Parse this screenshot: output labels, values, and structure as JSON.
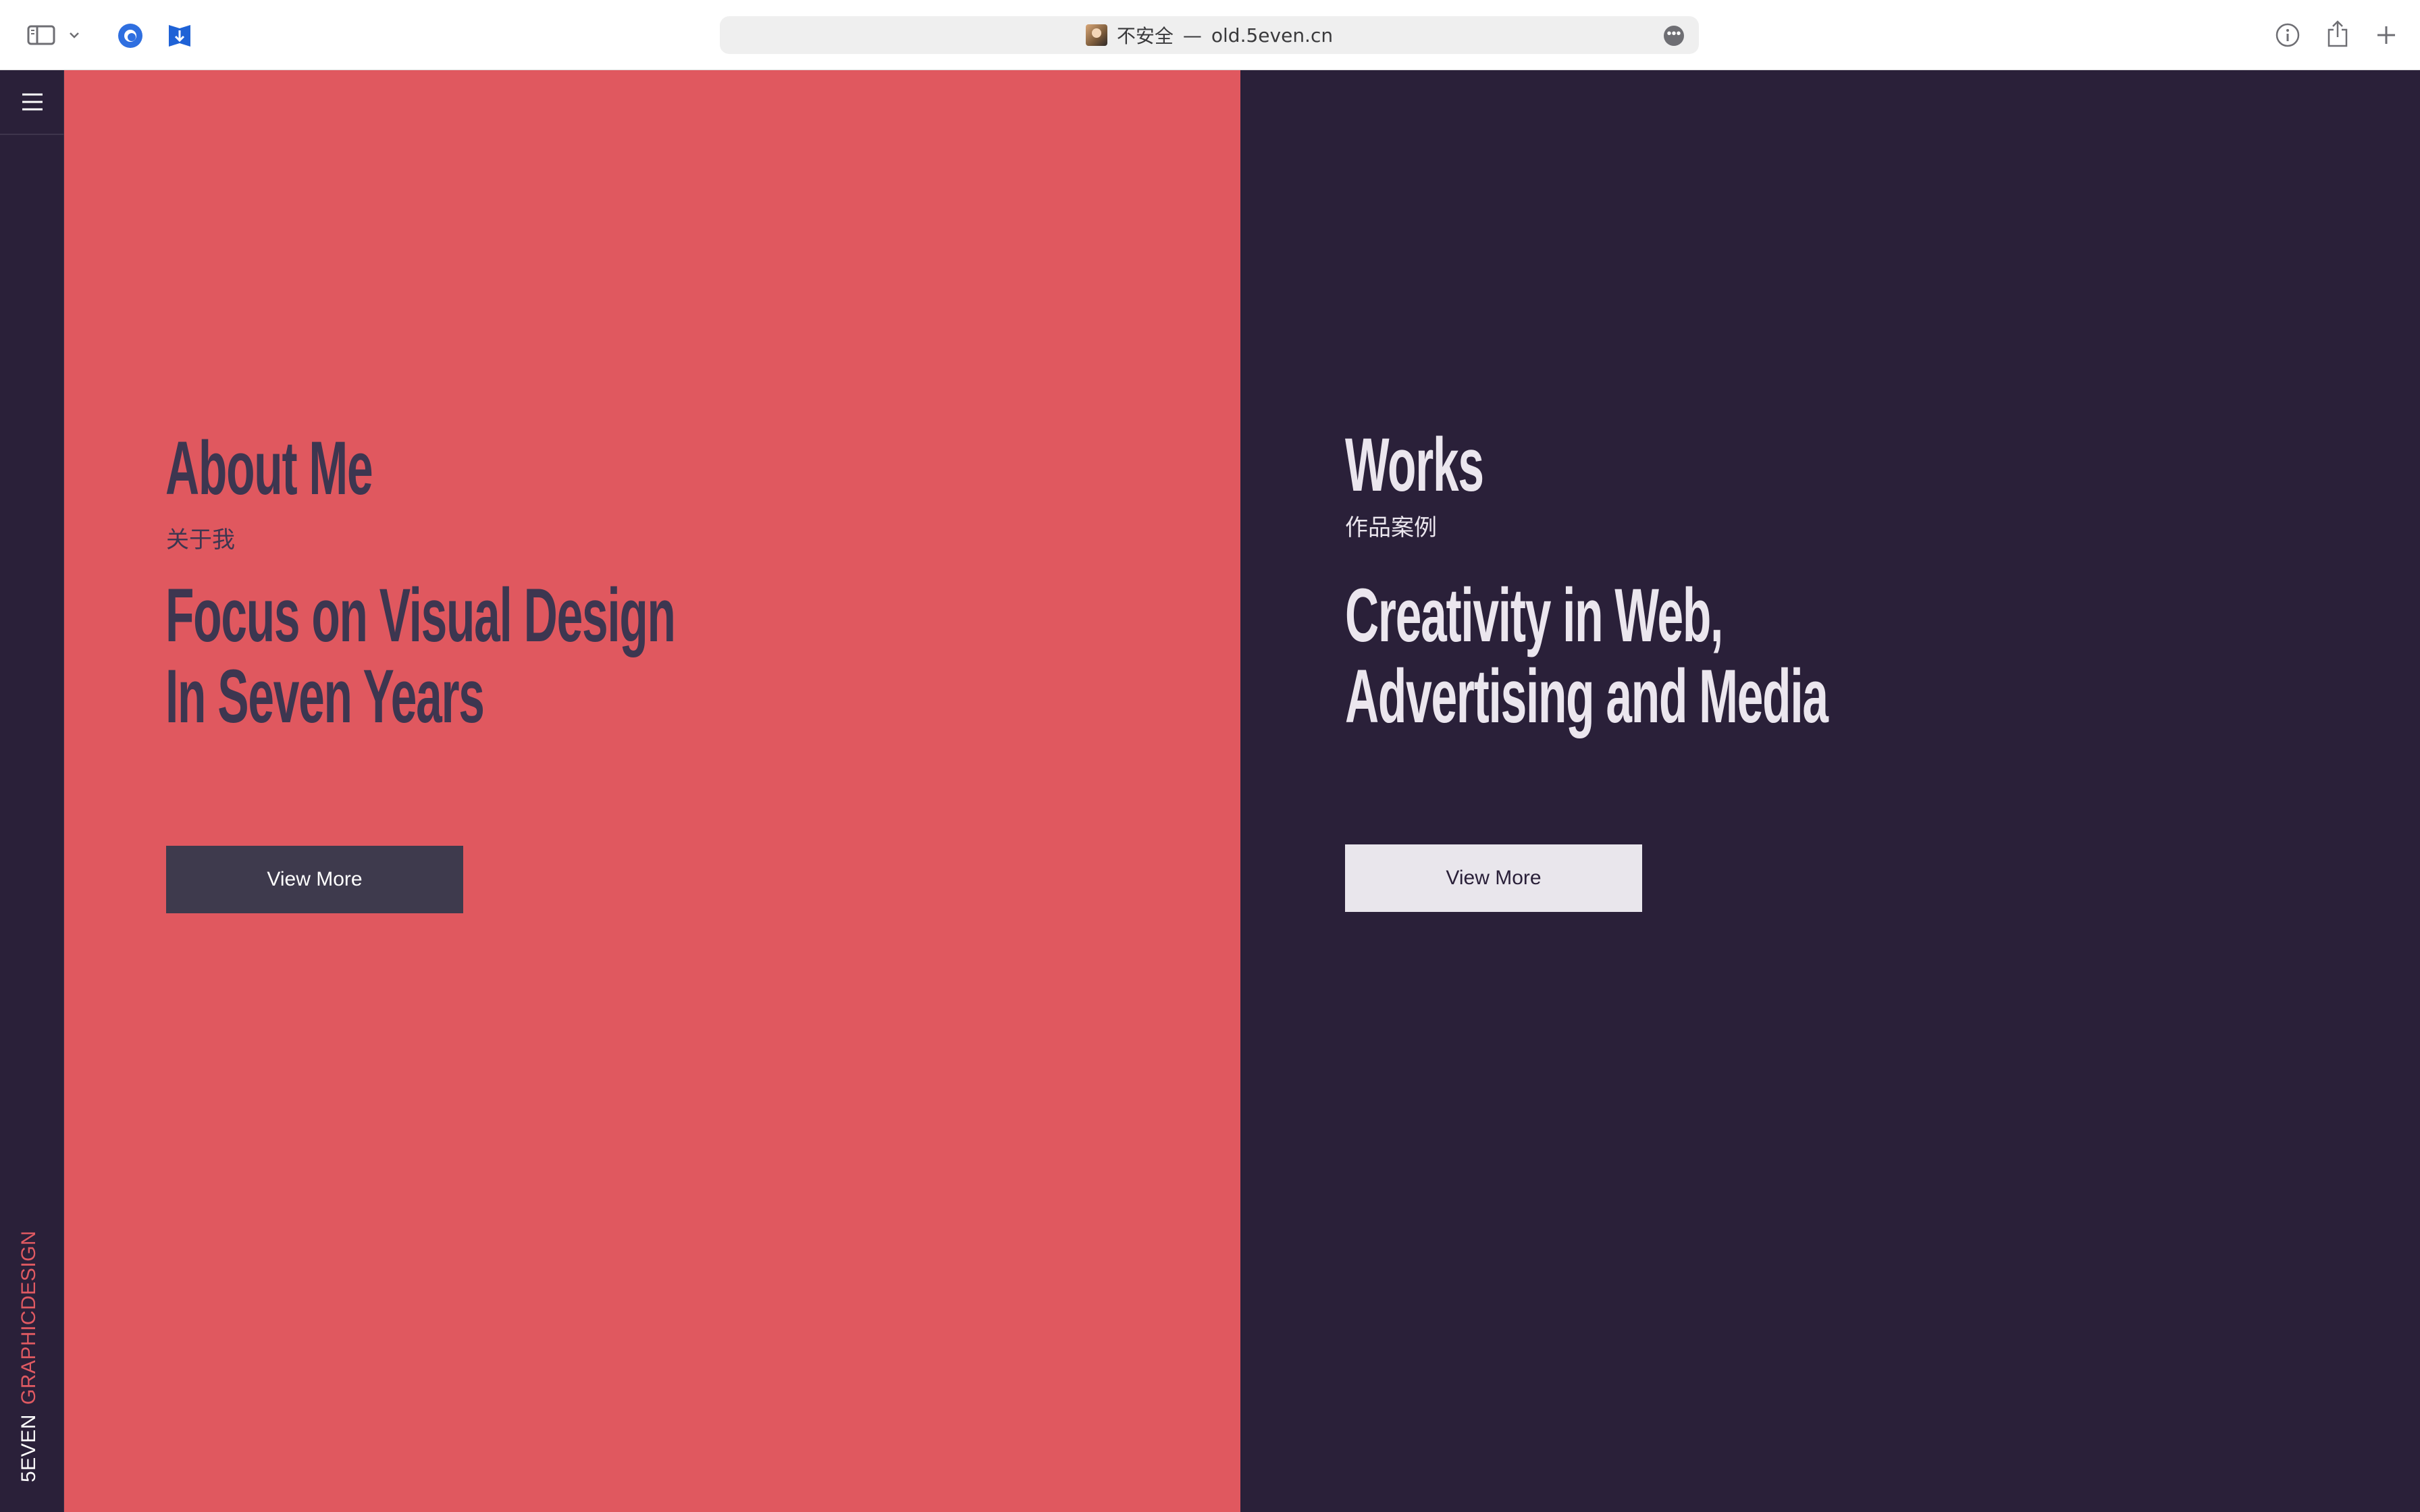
{
  "browser": {
    "address": {
      "security_label": "不安全",
      "separator": "—",
      "host": "old.5even.cn"
    },
    "icons": {
      "sidebar": "sidebar-toggle-icon",
      "sidebar_menu": "chevron-down-icon",
      "extension_1": "extension-blue-circle-icon",
      "extension_2": "extension-bookmark-icon",
      "page_menu": "ellipsis-icon",
      "info": "info-icon",
      "share": "share-icon",
      "new_tab": "plus-icon"
    }
  },
  "site": {
    "rail": {
      "menu_icon": "hamburger-icon",
      "brand_primary": "5EVEN",
      "brand_secondary": "GRAPHICDESIGN"
    },
    "about": {
      "heading": "About Me",
      "subheading": "关于我",
      "tagline_lines": [
        "Focus on Visual Design",
        "In Seven Years"
      ],
      "button_label": "View More"
    },
    "works": {
      "heading": "Works",
      "subheading": "作品案例",
      "tagline_lines": [
        "Creativity in Web,",
        "Advertising and Media"
      ],
      "button_label": "View More"
    }
  },
  "colors": {
    "about_bg": "#e0585f",
    "works_bg": "#2a2039",
    "about_text": "#3d3650",
    "works_text": "#ebe6ee",
    "brand_accent": "#e05a62"
  }
}
